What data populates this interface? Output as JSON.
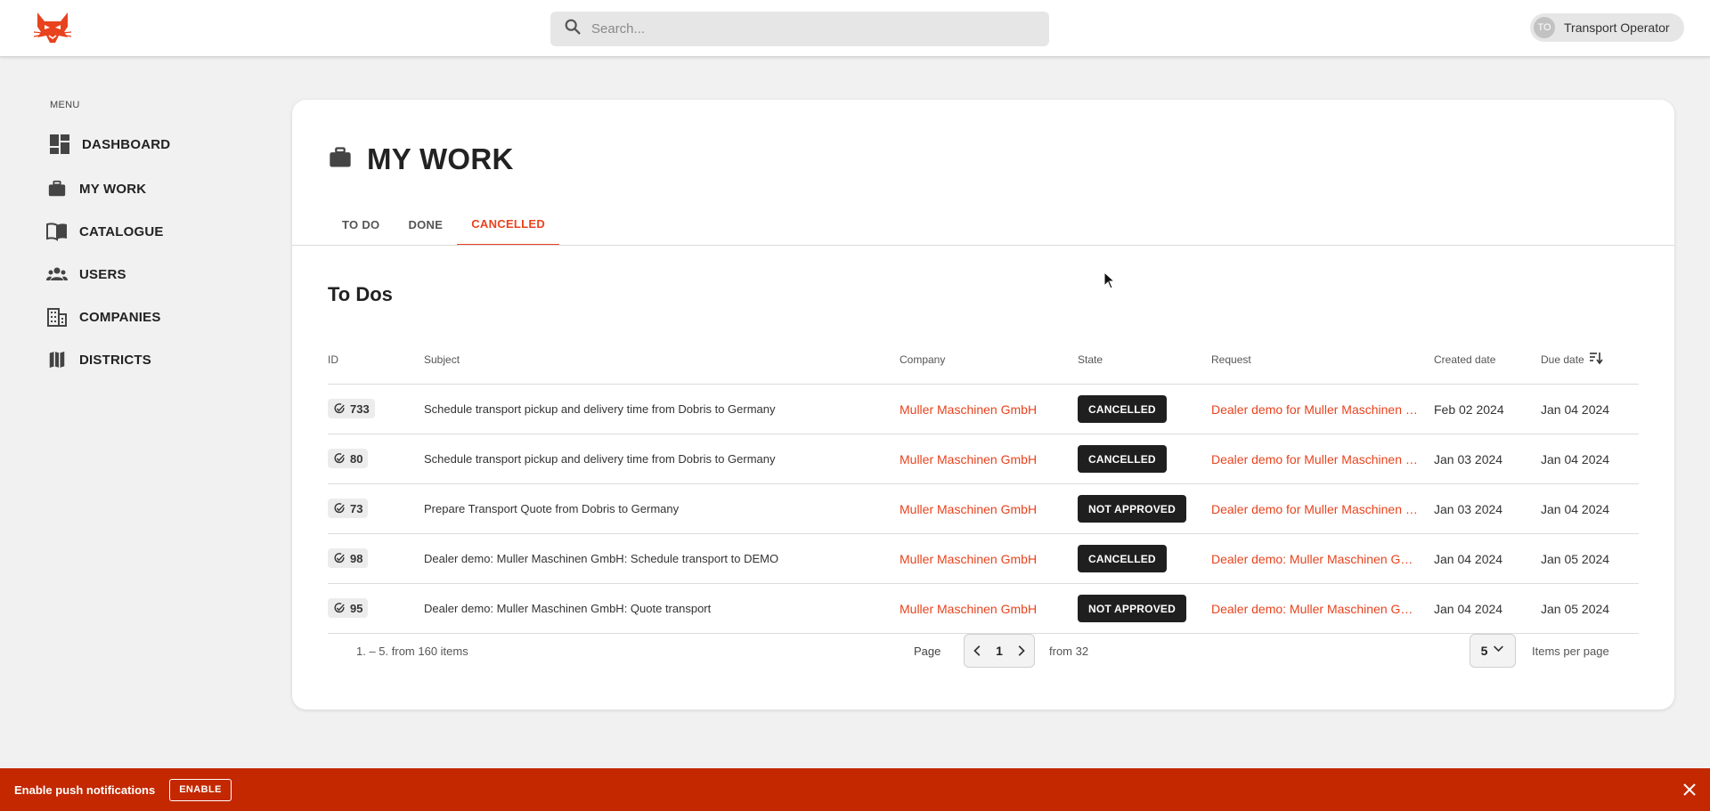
{
  "header": {
    "search_placeholder": "Search...",
    "user": {
      "initials": "TO",
      "name": "Transport Operator"
    }
  },
  "sidebar": {
    "menu_label": "MENU",
    "items": [
      {
        "label": "DASHBOARD",
        "icon": "dashboard-icon"
      },
      {
        "label": "MY WORK",
        "icon": "briefcase-icon"
      },
      {
        "label": "CATALOGUE",
        "icon": "book-icon"
      },
      {
        "label": "USERS",
        "icon": "users-icon"
      },
      {
        "label": "COMPANIES",
        "icon": "building-icon"
      },
      {
        "label": "DISTRICTS",
        "icon": "map-icon"
      }
    ]
  },
  "page": {
    "title": "MY WORK",
    "tabs": [
      {
        "label": "TO DO",
        "active": false
      },
      {
        "label": "DONE",
        "active": false
      },
      {
        "label": "CANCELLED",
        "active": true
      }
    ],
    "section_title": "To Dos"
  },
  "table": {
    "columns": [
      "ID",
      "Subject",
      "Company",
      "State",
      "Request",
      "Created date",
      "Due date"
    ],
    "rows": [
      {
        "id": "733",
        "subject": "Schedule transport pickup and delivery time from Dobris to Germany",
        "company": "Muller Maschinen GmbH",
        "state": "CANCELLED",
        "request": "Dealer demo for Muller Maschinen GmbH",
        "created": "Feb 02 2024",
        "due": "Jan 04 2024"
      },
      {
        "id": "80",
        "subject": "Schedule transport pickup and delivery time from Dobris to Germany",
        "company": "Muller Maschinen GmbH",
        "state": "CANCELLED",
        "request": "Dealer demo for Muller Maschinen GmbH",
        "created": "Jan 03 2024",
        "due": "Jan 04 2024"
      },
      {
        "id": "73",
        "subject": "Prepare Transport Quote from Dobris to Germany",
        "company": "Muller Maschinen GmbH",
        "state": "NOT APPROVED",
        "request": "Dealer demo for Muller Maschinen GmbH",
        "created": "Jan 03 2024",
        "due": "Jan 04 2024"
      },
      {
        "id": "98",
        "subject": "Dealer demo: Muller Maschinen GmbH: Schedule transport to DEMO",
        "company": "Muller Maschinen GmbH",
        "state": "CANCELLED",
        "request": "Dealer demo: Muller Maschinen GmbH",
        "created": "Jan 04 2024",
        "due": "Jan 05 2024"
      },
      {
        "id": "95",
        "subject": "Dealer demo: Muller Maschinen GmbH: Quote transport",
        "company": "Muller Maschinen GmbH",
        "state": "NOT APPROVED",
        "request": "Dealer demo: Muller Maschinen GmbH",
        "created": "Jan 04 2024",
        "due": "Jan 05 2024"
      }
    ]
  },
  "pagination": {
    "range_text": "1. – 5. from 160 items",
    "page_label": "Page",
    "current_page": "1",
    "from_text": "from 32",
    "items_per_page_value": "5",
    "items_per_page_label": "Items per page"
  },
  "notification": {
    "message": "Enable push notifications",
    "button_label": "ENABLE"
  },
  "colors": {
    "accent": "#e8431e",
    "notification_bg": "#c32800",
    "badge_bg": "#1f1f1f"
  }
}
